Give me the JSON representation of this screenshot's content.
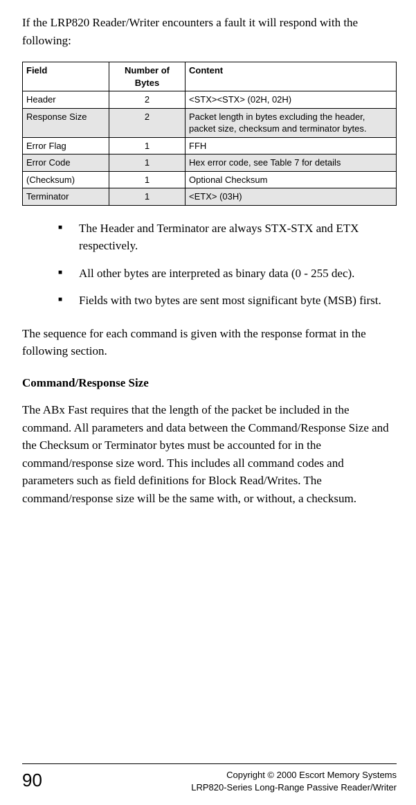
{
  "intro": "If the LRP820 Reader/Writer encounters a fault it will respond with the following:",
  "table": {
    "headers": [
      "Field",
      "Number of Bytes",
      "Content"
    ],
    "rows": [
      {
        "field": "Header",
        "bytes": "2",
        "content": "<STX><STX> (02H, 02H)",
        "shade": false
      },
      {
        "field": "Response Size",
        "bytes": "2",
        "content": "Packet length in bytes excluding the header, packet size, checksum and terminator bytes.",
        "shade": true
      },
      {
        "field": "Error Flag",
        "bytes": "1",
        "content": "FFH",
        "shade": false
      },
      {
        "field": "Error Code",
        "bytes": "1",
        "content": "Hex error code, see Table 7 for details",
        "shade": true
      },
      {
        "field": "(Checksum)",
        "bytes": "1",
        "content": "Optional Checksum",
        "shade": false
      },
      {
        "field": "Terminator",
        "bytes": "1",
        "content": "<ETX> (03H)",
        "shade": true
      }
    ]
  },
  "bullets": [
    "The Header and Terminator are always STX-STX and ETX respectively.",
    "All other bytes are interpreted as binary data (0 - 255 dec).",
    "Fields with two bytes are sent most significant byte (MSB) first."
  ],
  "sequence_para": "The sequence for each command is given with the response format in the following section.",
  "subheading": "Command/Response Size",
  "body_para": "The ABx Fast requires that the length of the packet be included in the command. All parameters and data between the Command/Response Size and the Checksum or Terminator bytes must be accounted for in the command/response size word. This includes all command codes and parameters such as field definitions for Block Read/Writes. The command/response size will be the same with, or without, a checksum.",
  "footer": {
    "page": "90",
    "line1": "Copyright © 2000 Escort Memory Systems",
    "line2": "LRP820-Series Long-Range Passive Reader/Writer"
  }
}
